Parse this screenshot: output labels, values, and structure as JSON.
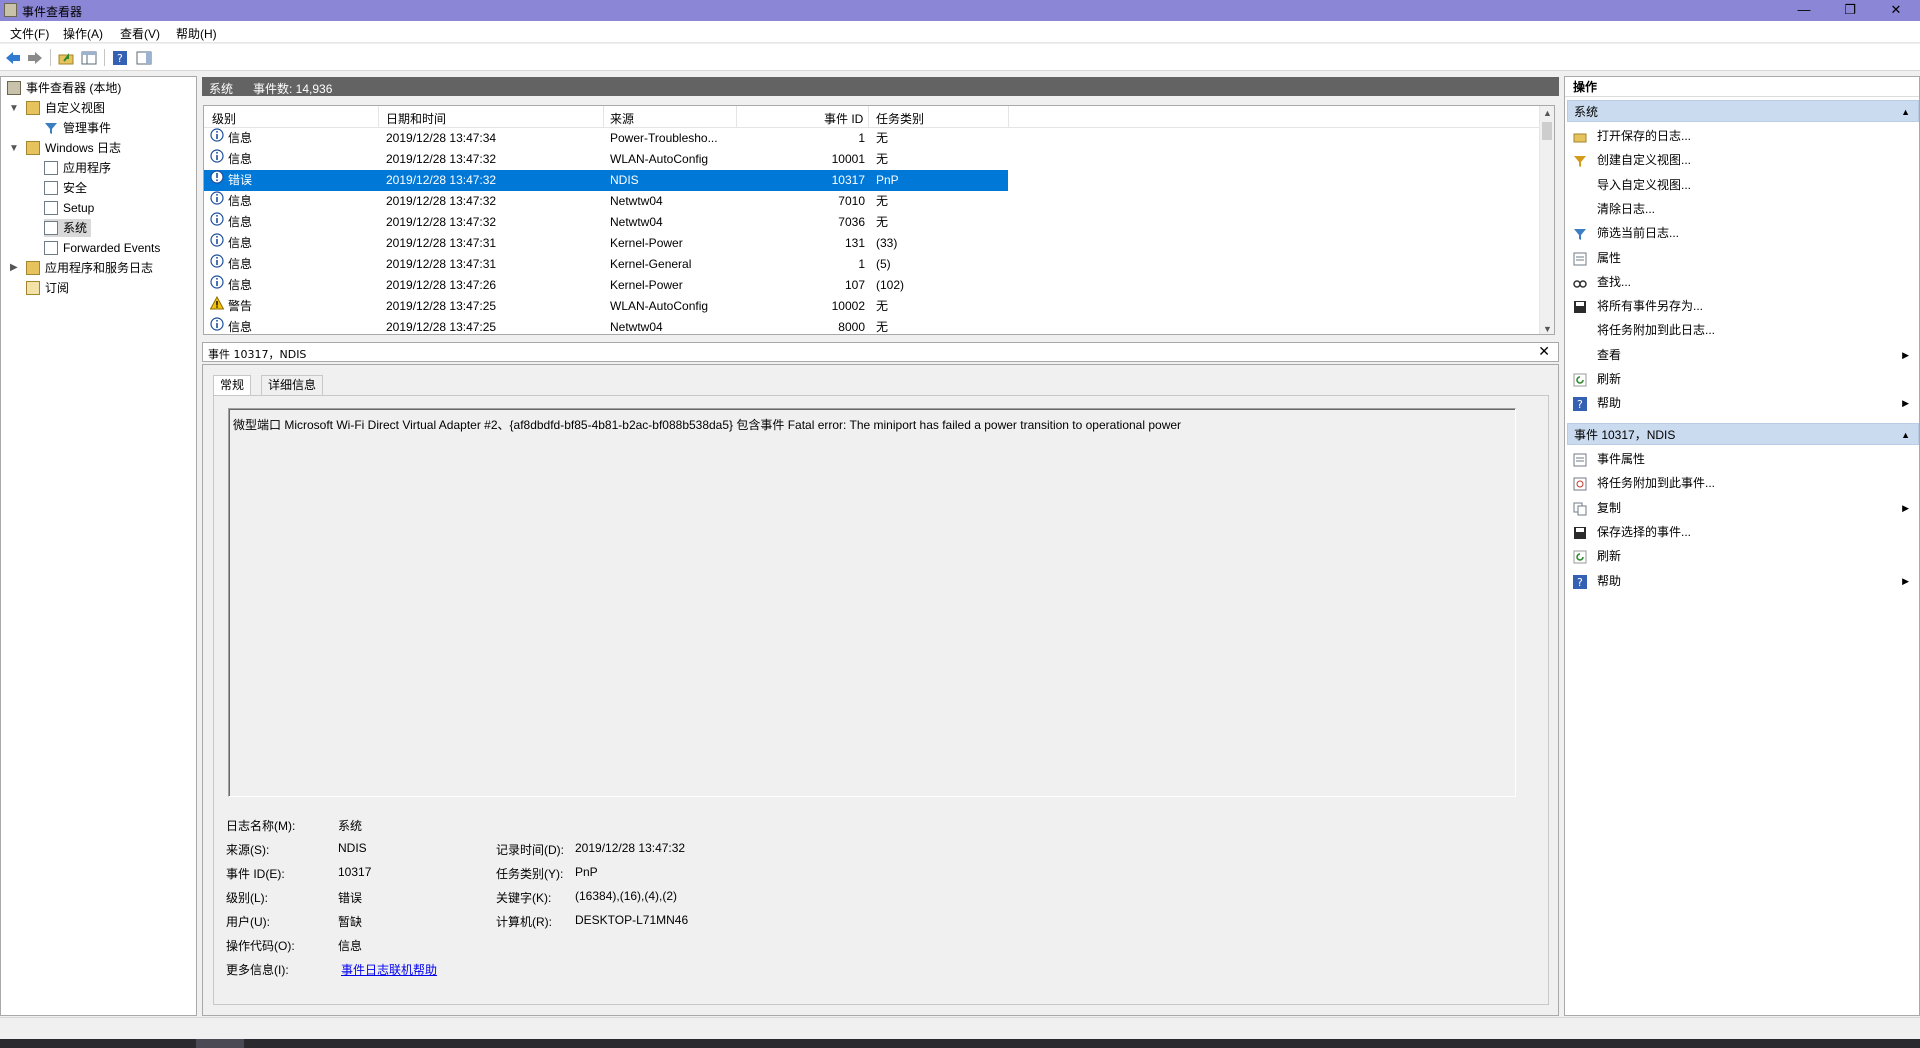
{
  "window": {
    "title": "事件查看器",
    "min": "—",
    "max": "❐",
    "close": "✕"
  },
  "menu": [
    "文件(F)",
    "操作(A)",
    "查看(V)",
    "帮助(H)"
  ],
  "tree": [
    {
      "label": "事件查看器 (本地)",
      "level": 0
    },
    {
      "label": "自定义视图",
      "level": 1
    },
    {
      "label": "管理事件",
      "level": 2
    },
    {
      "label": "Windows 日志",
      "level": 1
    },
    {
      "label": "应用程序",
      "level": 2
    },
    {
      "label": "安全",
      "level": 2
    },
    {
      "label": "Setup",
      "level": 2
    },
    {
      "label": "系统",
      "level": 2
    },
    {
      "label": "Forwarded Events",
      "level": 2
    },
    {
      "label": "应用程序和服务日志",
      "level": 1
    },
    {
      "label": "订阅",
      "level": 1
    }
  ],
  "center_header": {
    "log": "系统",
    "count": "事件数: 14,936"
  },
  "columns": [
    "级别",
    "日期和时间",
    "来源",
    "事件 ID",
    "任务类别"
  ],
  "events": [
    {
      "level": "信息",
      "time": "2019/12/28 13:47:34",
      "source": "Power-Troublesho...",
      "id": "1",
      "task": "无",
      "type": "info"
    },
    {
      "level": "信息",
      "time": "2019/12/28 13:47:32",
      "source": "WLAN-AutoConfig",
      "id": "10001",
      "task": "无",
      "type": "info"
    },
    {
      "level": "错误",
      "time": "2019/12/28 13:47:32",
      "source": "NDIS",
      "id": "10317",
      "task": "PnP",
      "type": "error"
    },
    {
      "level": "信息",
      "time": "2019/12/28 13:47:32",
      "source": "Netwtw04",
      "id": "7010",
      "task": "无",
      "type": "info"
    },
    {
      "level": "信息",
      "time": "2019/12/28 13:47:32",
      "source": "Netwtw04",
      "id": "7036",
      "task": "无",
      "type": "info"
    },
    {
      "level": "信息",
      "time": "2019/12/28 13:47:31",
      "source": "Kernel-Power",
      "id": "131",
      "task": "(33)",
      "type": "info"
    },
    {
      "level": "信息",
      "time": "2019/12/28 13:47:31",
      "source": "Kernel-General",
      "id": "1",
      "task": "(5)",
      "type": "info"
    },
    {
      "level": "信息",
      "time": "2019/12/28 13:47:26",
      "source": "Kernel-Power",
      "id": "107",
      "task": "(102)",
      "type": "info"
    },
    {
      "level": "警告",
      "time": "2019/12/28 13:47:25",
      "source": "WLAN-AutoConfig",
      "id": "10002",
      "task": "无",
      "type": "warning"
    },
    {
      "level": "信息",
      "time": "2019/12/28 13:47:25",
      "source": "Netwtw04",
      "id": "8000",
      "task": "无",
      "type": "info"
    }
  ],
  "detail": {
    "title": "事件 10317，NDIS",
    "tabs": [
      "常规",
      "详细信息"
    ],
    "message": "微型端口 Microsoft Wi-Fi Direct Virtual Adapter #2、{af8dbdfd-bf85-4b81-b2ac-bf088b538da5} 包含事件 Fatal error: The miniport has failed a power transition to operational power",
    "labels": {
      "log_name": "日志名称(M):",
      "source": "来源(S):",
      "event_id": "事件 ID(E):",
      "level": "级别(L):",
      "user": "用户(U):",
      "opcode": "操作代码(O):",
      "more_info": "更多信息(I):",
      "logged": "记录时间(D):",
      "task": "任务类别(Y):",
      "keywords": "关键字(K):",
      "computer": "计算机(R):"
    },
    "values": {
      "log_name": "系统",
      "source": "NDIS",
      "event_id": "10317",
      "level": "错误",
      "user": "暂缺",
      "opcode": "信息",
      "more_info": "事件日志联机帮助",
      "logged": "2019/12/28 13:47:32",
      "task": "PnP",
      "keywords": "(16384),(16),(4),(2)",
      "computer": "DESKTOP-L71MN46"
    }
  },
  "actions": {
    "title": "操作",
    "section1": "系统",
    "section1_items": [
      {
        "label": "打开保存的日志...",
        "icon": "open-folder-icon"
      },
      {
        "label": "创建自定义视图...",
        "icon": "filter-create-icon"
      },
      {
        "label": "导入自定义视图...",
        "icon": ""
      },
      {
        "label": "清除日志...",
        "icon": ""
      },
      {
        "label": "筛选当前日志...",
        "icon": "filter-icon"
      },
      {
        "label": "属性",
        "icon": "properties-icon"
      },
      {
        "label": "查找...",
        "icon": "find-icon"
      },
      {
        "label": "将所有事件另存为...",
        "icon": "save-icon"
      },
      {
        "label": "将任务附加到此日志...",
        "icon": ""
      },
      {
        "label": "查看",
        "icon": "",
        "sub": true
      },
      {
        "label": "刷新",
        "icon": "refresh-icon"
      },
      {
        "label": "帮助",
        "icon": "help-icon",
        "sub": true
      }
    ],
    "section2": "事件 10317，NDIS",
    "section2_items": [
      {
        "label": "事件属性",
        "icon": "event-properties-icon"
      },
      {
        "label": "将任务附加到此事件...",
        "icon": "task-icon"
      },
      {
        "label": "复制",
        "icon": "copy-icon",
        "sub": true
      },
      {
        "label": "保存选择的事件...",
        "icon": "save-icon"
      },
      {
        "label": "刷新",
        "icon": "refresh-icon"
      },
      {
        "label": "帮助",
        "icon": "help-icon",
        "sub": true
      }
    ]
  },
  "colors": {
    "title_bar": "#8b87d6",
    "selection": "#0078d7",
    "section_header": "#cbdbef"
  }
}
